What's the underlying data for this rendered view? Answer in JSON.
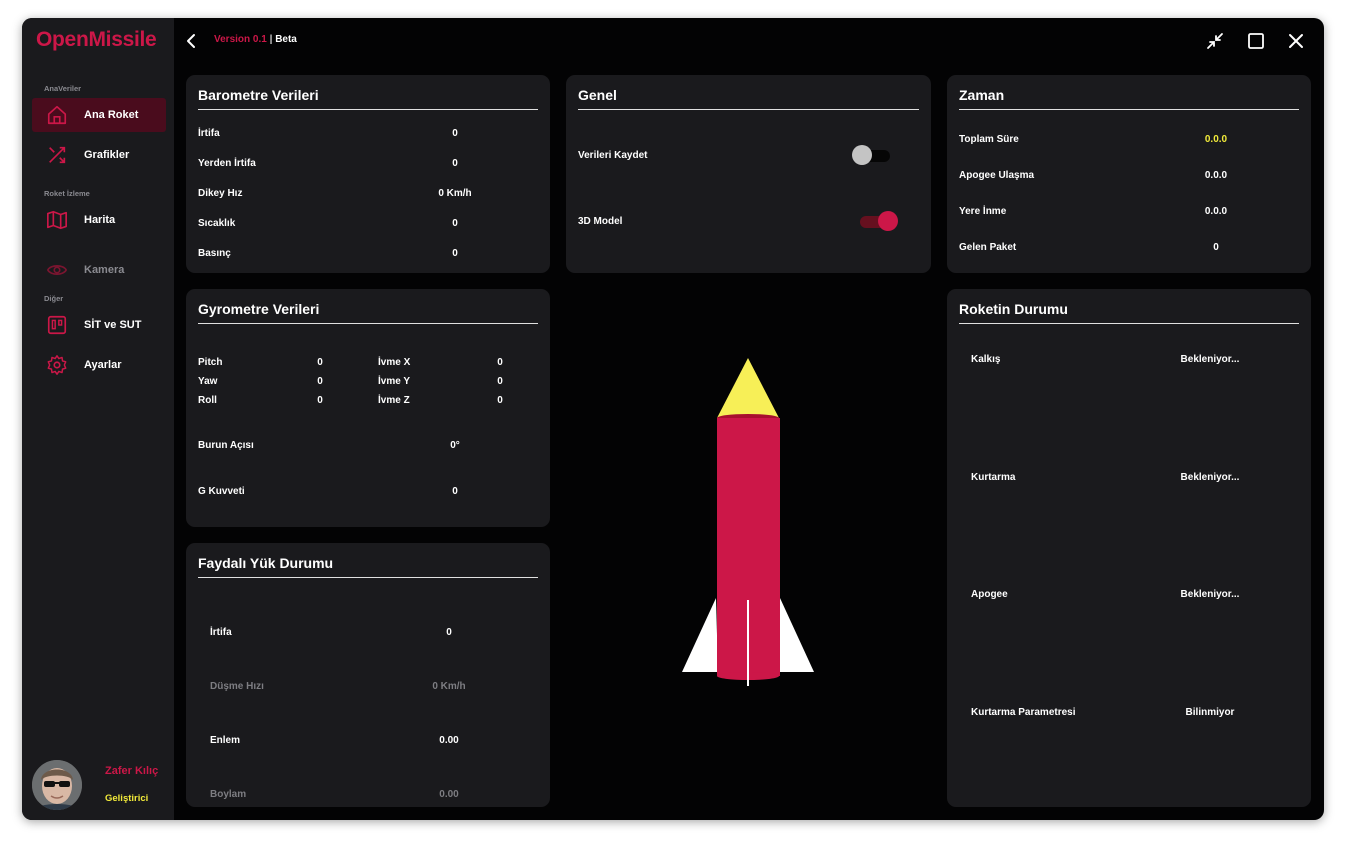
{
  "app": {
    "logo": "OpenMissile",
    "version_label": "Version 0.1",
    "version_sep": "|",
    "version_tag": "Beta"
  },
  "sidebar": {
    "sections": [
      "AnaVeriler",
      "Roket İzleme",
      "Diğer"
    ],
    "items": [
      {
        "label": "Ana Roket",
        "icon": "home-icon"
      },
      {
        "label": "Grafikler",
        "icon": "shuffle-icon"
      },
      {
        "label": "Harita",
        "icon": "map-icon"
      },
      {
        "label": "Kamera",
        "icon": "eye-icon"
      },
      {
        "label": "SİT ve SUT",
        "icon": "kanban-icon"
      },
      {
        "label": "Ayarlar",
        "icon": "gear-icon"
      }
    ]
  },
  "user": {
    "name": "Zafer Kılıç",
    "role": "Geliştirici"
  },
  "barometer": {
    "title": "Barometre Verileri",
    "rows": [
      {
        "label": "İrtifa",
        "value": "0"
      },
      {
        "label": "Yerden İrtifa",
        "value": "0"
      },
      {
        "label": "Dikey Hız",
        "value": "0 Km/h"
      },
      {
        "label": "Sıcaklık",
        "value": "0"
      },
      {
        "label": "Basınç",
        "value": "0"
      }
    ]
  },
  "general": {
    "title": "Genel",
    "save_label": "Verileri Kaydet",
    "model_label": "3D Model",
    "save_enabled": false,
    "model_enabled": true
  },
  "time": {
    "title": "Zaman",
    "rows": [
      {
        "label": "Toplam Süre",
        "value": "0.0.0"
      },
      {
        "label": "Apogee Ulaşma",
        "value": "0.0.0"
      },
      {
        "label": "Yere İnme",
        "value": "0.0.0"
      },
      {
        "label": "Gelen Paket",
        "value": "0"
      }
    ]
  },
  "gyro": {
    "title": "Gyrometre Verileri",
    "axes": [
      {
        "label": "Pitch",
        "value": "0",
        "accel_label": "İvme X",
        "accel_value": "0"
      },
      {
        "label": "Yaw",
        "value": "0",
        "accel_label": "İvme Y",
        "accel_value": "0"
      },
      {
        "label": "Roll",
        "value": "0",
        "accel_label": "İvme Z",
        "accel_value": "0"
      }
    ],
    "nose_label": "Burun Açısı",
    "nose_value": "0°",
    "g_label": "G Kuvveti",
    "g_value": "0"
  },
  "payload": {
    "title": "Faydalı Yük Durumu",
    "rows": [
      {
        "label": "İrtifa",
        "value": "0"
      },
      {
        "label": "Düşme Hızı",
        "value": "0 Km/h"
      },
      {
        "label": "Enlem",
        "value": "0.00"
      },
      {
        "label": "Boylam",
        "value": "0.00"
      }
    ]
  },
  "status": {
    "title": "Roketin Durumu",
    "rows": [
      {
        "label": "Kalkış",
        "value": "Bekleniyor..."
      },
      {
        "label": "Kurtarma",
        "value": "Bekleniyor..."
      },
      {
        "label": "Apogee",
        "value": "Bekleniyor..."
      },
      {
        "label": "Kurtarma Parametresi",
        "value": "Bilinmiyor"
      }
    ]
  },
  "colors": {
    "accent": "#cc1748",
    "highlight": "#f1ea3a",
    "card_bg": "#1a1a1d",
    "window_bg": "#030304"
  }
}
